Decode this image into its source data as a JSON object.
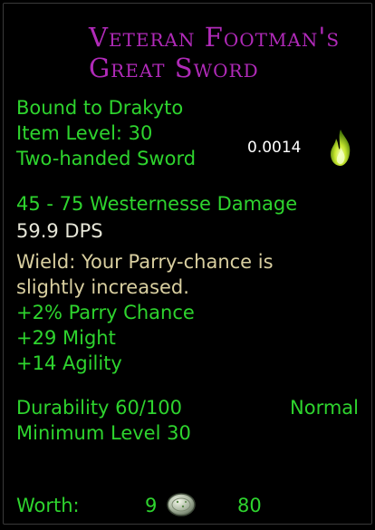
{
  "item": {
    "name_line1": "Veteran Footman's",
    "name_line2": "Great Sword",
    "bound": "Bound to Drakyto",
    "item_level": "Item Level: 30",
    "type": "Two-handed Sword",
    "stack_value": "0.0014",
    "damage": "45 - 75 Westernesse Damage",
    "dps": "59.9 DPS",
    "wield_line1": "Wield: Your Parry-chance is",
    "wield_line2": "slightly increased.",
    "stats": [
      "+2% Parry Chance",
      "+29 Might",
      "+14 Agility"
    ],
    "durability": "Durability 60/100",
    "quality": "Normal",
    "min_level": "Minimum Level 30",
    "worth_label": "Worth:",
    "worth_silver": "9",
    "worth_copper": "80"
  },
  "colors": {
    "title": "#b02ab8",
    "green": "#2ed42e",
    "white": "#e6e6d8",
    "tan": "#d9cfa0",
    "background": "#000000"
  },
  "icons": {
    "legendary_flame": "green-flame-icon",
    "silver_coin": "silver-coin-icon"
  }
}
